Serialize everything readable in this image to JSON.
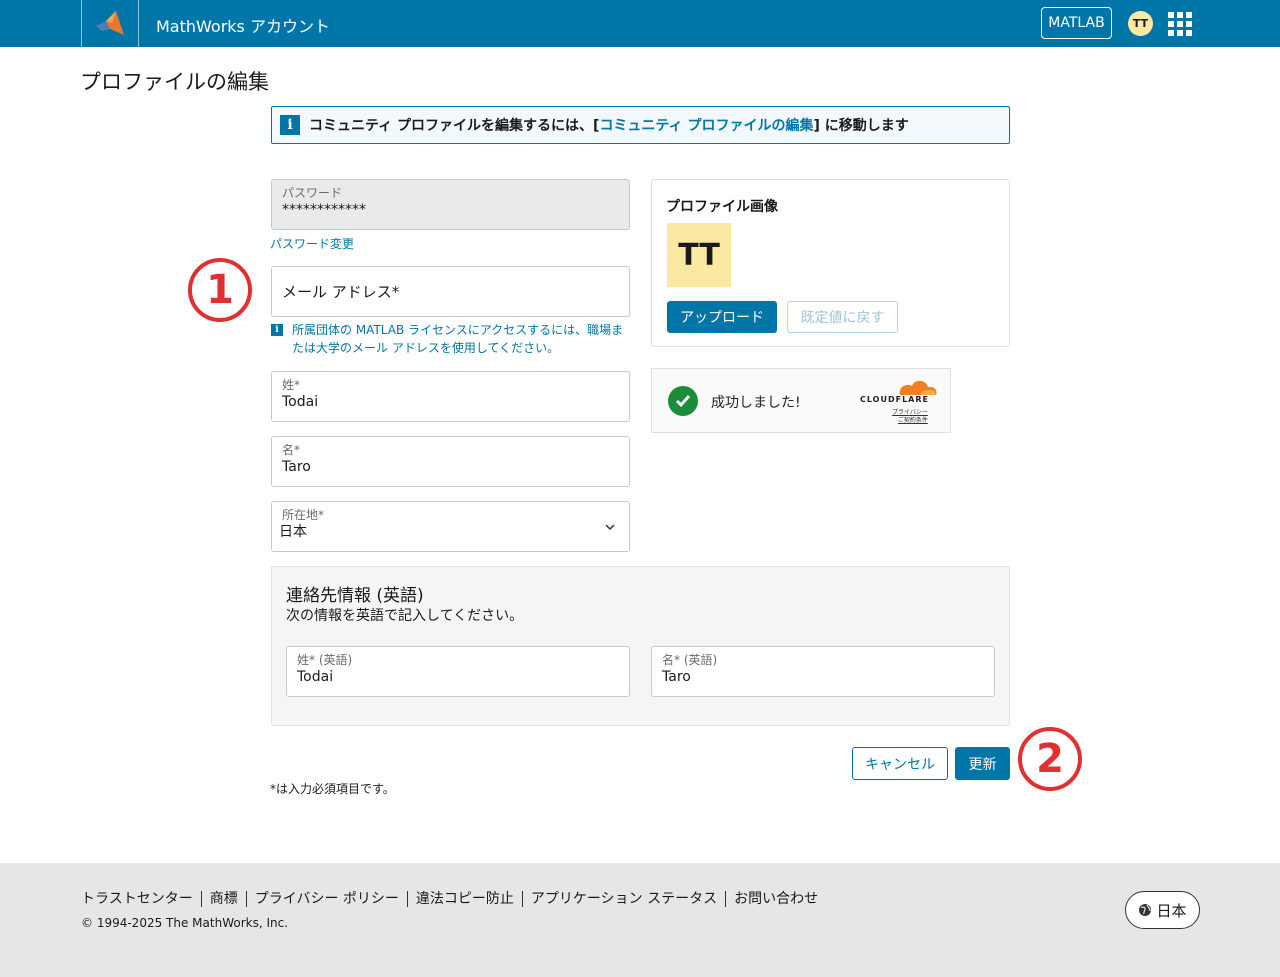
{
  "header": {
    "app_title": "MathWorks アカウント",
    "matlab_label": "MATLAB",
    "avatar_initials": "TT",
    "brand_color": "#0076a8"
  },
  "page_title": "プロファイルの編集",
  "banner": {
    "prefix": "コミュニティ プロファイルを編集するには、[",
    "link": "コミュニティ プロファイルの編集",
    "suffix": "] に移動します"
  },
  "form": {
    "password": {
      "label": "パスワード",
      "value": "************"
    },
    "password_change_link": "パスワード変更",
    "email": {
      "label": "メール アドレス*"
    },
    "email_note": "所属団体の MATLAB ライセンスにアクセスするには、職場または大学のメール アドレスを使用してください。",
    "last_name": {
      "label": "姓*",
      "value": "Todai"
    },
    "first_name": {
      "label": "名*",
      "value": "Taro"
    },
    "location": {
      "label": "所在地*",
      "value": "日本"
    }
  },
  "profile_image": {
    "title": "プロファイル画像",
    "initials": "TT",
    "upload_label": "アップロード",
    "reset_label": "既定値に戻す"
  },
  "cloudflare": {
    "status": "成功しました!",
    "brand": "CLOUDFLARE",
    "privacy": "プライバシー",
    "terms": "ご契約条件"
  },
  "contact": {
    "title": "連絡先情報 (英語)",
    "description": "次の情報を英語で記入してください。",
    "last_name": {
      "label": "姓* (英語)",
      "value": "Todai"
    },
    "first_name": {
      "label": "名* (英語)",
      "value": "Taro"
    }
  },
  "actions": {
    "cancel_label": "キャンセル",
    "update_label": "更新"
  },
  "required_note": "*は入力必須項目です。",
  "annotations": {
    "marker_1": "1",
    "marker_2": "2"
  },
  "footer": {
    "links": [
      "トラストセンター",
      "商標",
      "プライバシー ポリシー",
      "違法コピー防止",
      "アプリケーション ステータス",
      "お問い合わせ"
    ],
    "copyright": "© 1994-2025 The MathWorks, Inc.",
    "language": "日本"
  }
}
